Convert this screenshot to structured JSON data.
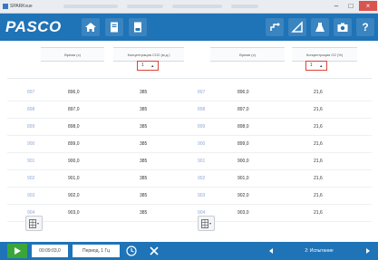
{
  "window": {
    "title": "SPARKvue"
  },
  "app": {
    "logo": "PASCO"
  },
  "left_table": {
    "col_time_header": "Время (с)",
    "col_value_header": "Концентрация CO2 (м.д.)",
    "filter_value": "1",
    "rows": [
      {
        "idx": "897",
        "time": "896,0",
        "value": "385"
      },
      {
        "idx": "898",
        "time": "897,0",
        "value": "385"
      },
      {
        "idx": "899",
        "time": "898,0",
        "value": "385"
      },
      {
        "idx": "900",
        "time": "899,0",
        "value": "385"
      },
      {
        "idx": "901",
        "time": "900,0",
        "value": "385"
      },
      {
        "idx": "902",
        "time": "901,0",
        "value": "385"
      },
      {
        "idx": "903",
        "time": "902,0",
        "value": "385"
      },
      {
        "idx": "904",
        "time": "903,0",
        "value": "385"
      }
    ]
  },
  "right_table": {
    "col_time_header": "Время (с)",
    "col_value_header": "Концентрация O2 (%)",
    "filter_value": "1",
    "rows": [
      {
        "idx": "897",
        "time": "896,0",
        "value": "21,6"
      },
      {
        "idx": "898",
        "time": "897,0",
        "value": "21,6"
      },
      {
        "idx": "899",
        "time": "898,0",
        "value": "21,6"
      },
      {
        "idx": "900",
        "time": "899,0",
        "value": "21,6"
      },
      {
        "idx": "901",
        "time": "900,0",
        "value": "21,6"
      },
      {
        "idx": "902",
        "time": "901,0",
        "value": "21,6"
      },
      {
        "idx": "903",
        "time": "902,0",
        "value": "21,6"
      },
      {
        "idx": "904",
        "time": "903,0",
        "value": "21,6"
      }
    ]
  },
  "bottom": {
    "elapsed_time": "00:09:03,0",
    "sample_rate": "Период, 1 Гц",
    "page_label": "2: Испытание"
  },
  "colors": {
    "toolbar": "#1f73b7",
    "play": "#3aa63a",
    "index_text": "#8fa8d8",
    "filter_border": "#e0413a"
  }
}
